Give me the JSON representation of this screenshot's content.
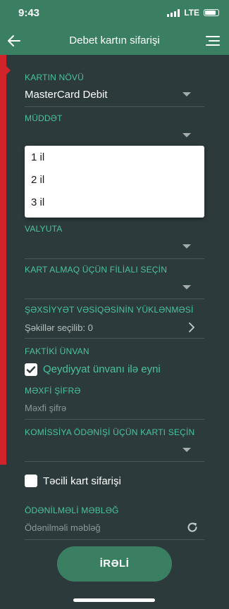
{
  "status_bar": {
    "time": "9:43",
    "network": "LTE"
  },
  "nav": {
    "title": "Debet kartın sifarişi",
    "back_icon": "arrow-left-icon",
    "menu_icon": "hamburger-icon"
  },
  "form": {
    "card_type": {
      "label": "KARTIN NÖVÜ",
      "value": "MasterCard Debit"
    },
    "term": {
      "label": "MÜDDƏT",
      "options": [
        "1 il",
        "2 il",
        "3 il"
      ]
    },
    "currency": {
      "label": "VALYUTA"
    },
    "branch": {
      "label": "KART ALMAQ ÜÇÜN FİLİALI SEÇİN"
    },
    "id_upload": {
      "label": "ŞƏXSİYYƏT VƏSİQƏSİNİN YÜKLƏNMƏSİ",
      "value": "Şəkillər seçilib: 0"
    },
    "actual_address": {
      "label": "FAKTİKİ ÜNVAN",
      "checkbox_label": "Qeydiyyat ünvanı ilə eyni",
      "checked": true
    },
    "secret_code": {
      "label": "MƏXFİ ŞİFRƏ",
      "placeholder": "Məxfi şifrə"
    },
    "commission_card": {
      "label": "KOMİSSİYA ÖDƏNİŞİ ÜÇÜN KARTI SEÇİN"
    },
    "urgent": {
      "label": "Təcili kart sifarişi",
      "checked": false
    },
    "payable_amount": {
      "label": "ÖDƏNİLMƏLİ MƏBLƏĞ",
      "placeholder": "Ödənilməli məbləğ"
    }
  },
  "next_button": {
    "label": "İRƏLİ"
  },
  "colors": {
    "primary": "#3b7f63",
    "accent": "#49c39e",
    "background": "#2d3a3c",
    "indicator": "#d1232a"
  }
}
